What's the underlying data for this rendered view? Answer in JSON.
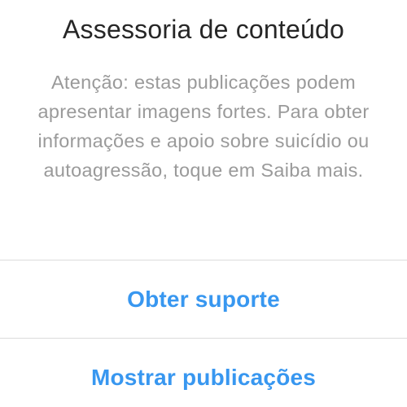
{
  "dialog": {
    "title": "Assessoria de conteúdo",
    "message": "Atenção: estas publicações podem apresentar imagens fortes. Para obter informações e apoio sobre suicídio ou autoagressão, toque em Saiba mais.",
    "actions": [
      {
        "label": "Obter suporte"
      },
      {
        "label": "Mostrar publicações"
      }
    ]
  },
  "colors": {
    "title": "#262626",
    "message": "#9a9a9a",
    "action": "#3897f0",
    "divider": "#dbdbdb",
    "background": "#ffffff"
  }
}
